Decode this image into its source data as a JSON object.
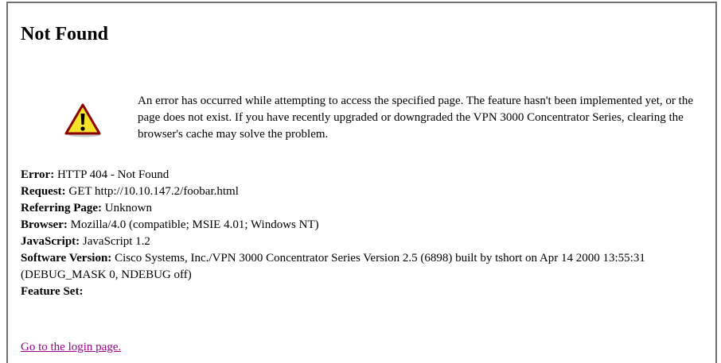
{
  "page": {
    "title": "Not Found",
    "message": "An error has occurred while attempting to access the specified page. The feature hasn't been implemented yet, or the page does not exist. If you have recently upgraded or downgraded the VPN 3000 Concentrator Series, clearing the browser's cache may solve the problem.",
    "icon": "warning-icon"
  },
  "details": {
    "error": {
      "label": "Error:",
      "value": "HTTP 404 - Not Found"
    },
    "request": {
      "label": "Request:",
      "value": "GET http://10.10.147.2/foobar.html"
    },
    "referring_page": {
      "label": "Referring Page:",
      "value": "Unknown"
    },
    "browser": {
      "label": "Browser:",
      "value": "Mozilla/4.0 (compatible; MSIE 4.01; Windows NT)"
    },
    "javascript": {
      "label": "JavaScript:",
      "value": "JavaScript 1.2"
    },
    "software_version": {
      "label": "Software Version:",
      "value": "Cisco Systems, Inc./VPN 3000 Concentrator Series Version 2.5 (6898) built by tshort on Apr 14 2000 13:55:31 (DEBUG_MASK 0, NDEBUG off)"
    },
    "feature_set": {
      "label": "Feature Set:",
      "value": ""
    }
  },
  "links": {
    "login": "Go to the login page."
  },
  "colors": {
    "link_visited": "#9a0089",
    "icon_fill": "#f5e22a",
    "icon_outline": "#8b0000",
    "frame_border": "#707070"
  }
}
